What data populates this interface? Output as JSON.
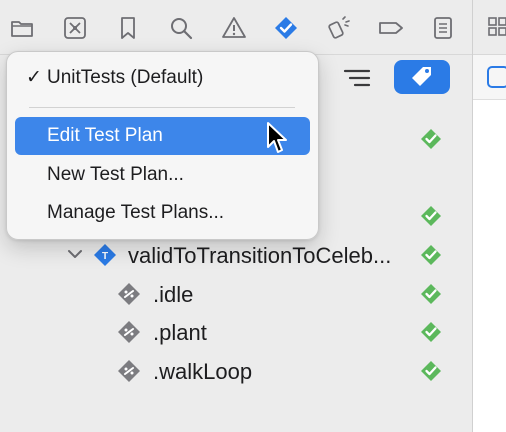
{
  "toolbar": {
    "icons": [
      "folder-icon",
      "source-control-icon",
      "bookmark-icon",
      "find-icon",
      "issue-warning-icon",
      "test-navigator-icon",
      "debug-icon",
      "breakpoint-icon",
      "report-icon"
    ],
    "active_icon": "test-navigator-icon",
    "accent_color": "#2b7be6"
  },
  "navigator": {
    "filter_icon": "list-filter-icon",
    "tag_icon": "tag-icon",
    "rows": [
      {
        "kind": "status-only",
        "status": "passed"
      },
      {
        "kind": "status-only",
        "status": "passed"
      },
      {
        "kind": "test-case",
        "label": "validToTransitionToCeleb...",
        "status": "passed",
        "expanded": true
      },
      {
        "kind": "argument",
        "label": ".idle",
        "status": "passed"
      },
      {
        "kind": "argument",
        "label": ".plant",
        "status": "passed"
      },
      {
        "kind": "argument",
        "label": ".walkLoop",
        "status": "passed"
      }
    ],
    "status_color": "#5cb85c"
  },
  "menu": {
    "items": [
      {
        "label": "UnitTests (Default)",
        "checked": true,
        "highlighted": false
      },
      {
        "label": "Edit Test Plan",
        "checked": false,
        "highlighted": true
      },
      {
        "label": "New Test Plan...",
        "checked": false,
        "highlighted": false
      },
      {
        "label": "Manage Test Plans...",
        "checked": false,
        "highlighted": false
      }
    ],
    "check_glyph": "✓",
    "highlight_color": "#3d86ea"
  },
  "editor": {
    "jumpbar_icon": "app-icon"
  }
}
